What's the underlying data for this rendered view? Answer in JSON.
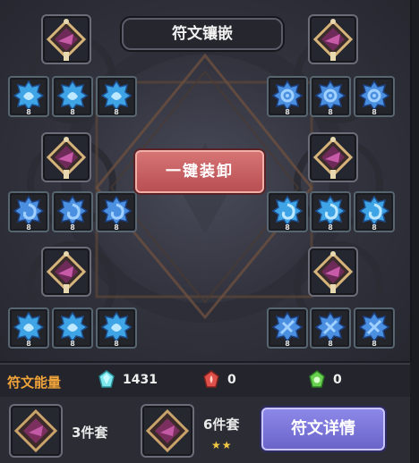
{
  "title": "符文镶嵌",
  "unload_button": "一键装卸",
  "socket_level": "8",
  "energy": {
    "label": "符文能量",
    "resources": [
      {
        "icon": "cyan-crystal-icon",
        "value": "1431",
        "color": "#7fe8ee"
      },
      {
        "icon": "red-crystal-icon",
        "value": "0",
        "color": "#e0504a"
      },
      {
        "icon": "green-crystal-icon",
        "value": "0",
        "color": "#6ad150"
      }
    ]
  },
  "sets": [
    {
      "label": "3件套"
    },
    {
      "label": "6件套",
      "stars": "★★"
    }
  ],
  "detail_button": "符文详情",
  "colors": {
    "energy_label": "#f0a43a",
    "socket_border": "#56656f",
    "unload": "#c45e60",
    "detail": "#7a74dc"
  }
}
